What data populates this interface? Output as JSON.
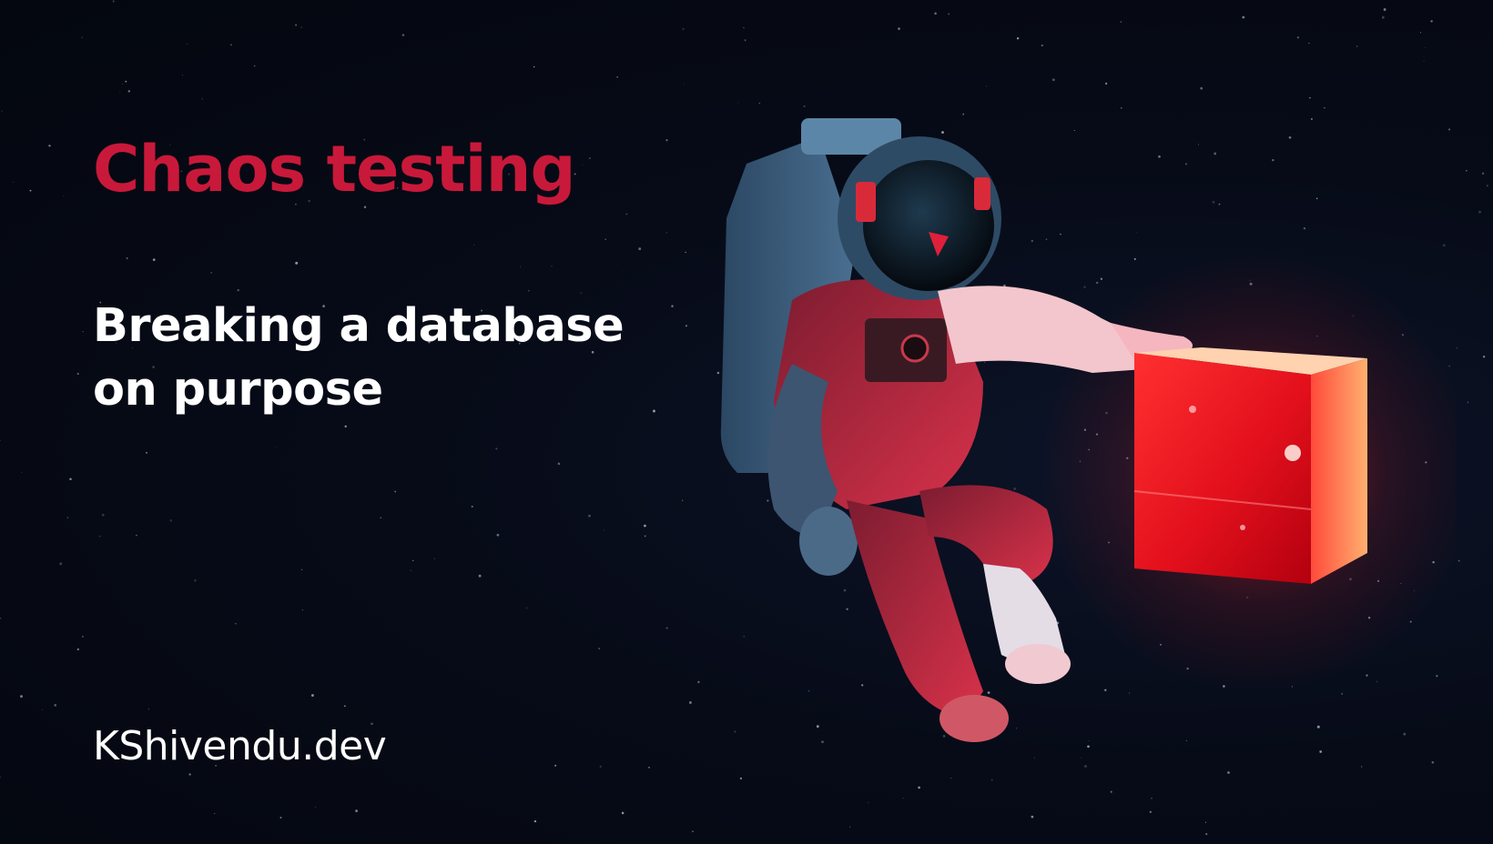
{
  "slide": {
    "title": "Chaos testing",
    "subtitle": "Breaking a database on purpose",
    "site": "KShivendu.dev"
  },
  "colors": {
    "background": "#060a17",
    "title_accent": "#c8193a",
    "text": "#ffffff",
    "cube_glow": "#ff2a2a",
    "suit_red": "#b8243a",
    "suit_blue": "#3d5f7e"
  },
  "illustration": {
    "icon": "astronaut-holding-glowing-red-cube-illustration"
  }
}
